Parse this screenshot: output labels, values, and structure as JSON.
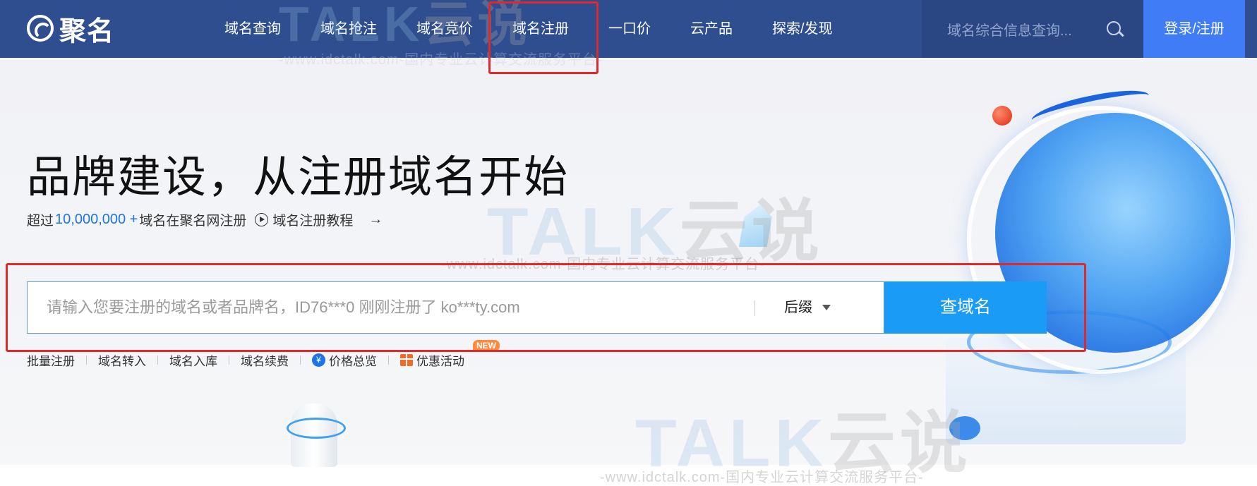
{
  "brand": {
    "logo_text": "聚名"
  },
  "nav": {
    "items": [
      {
        "label": "域名查询"
      },
      {
        "label": "域名抢注"
      },
      {
        "label": "域名竞价"
      },
      {
        "label": "域名注册"
      },
      {
        "label": "一口价"
      },
      {
        "label": "云产品"
      },
      {
        "label": "探索/发现"
      }
    ],
    "search_placeholder": "域名综合信息查询...",
    "login_label": "登录/注册"
  },
  "hero": {
    "headline": "品牌建设，从注册域名开始",
    "sub_prefix": "超过",
    "sub_number": "10,000,000 +",
    "sub_suffix": "域名在聚名网注册",
    "tutorial_label": "域名注册教程",
    "arrow": "→"
  },
  "search": {
    "placeholder": "请输入您要注册的域名或者品牌名，ID76***0 刚刚注册了 ko***ty.com",
    "suffix_label": "后缀",
    "button_label": "查域名"
  },
  "quick_links": [
    {
      "label": "批量注册"
    },
    {
      "label": "域名转入"
    },
    {
      "label": "域名入库"
    },
    {
      "label": "域名续费"
    },
    {
      "label": "价格总览",
      "icon": "yen-icon"
    },
    {
      "label": "优惠活动",
      "icon": "gift-icon"
    }
  ],
  "badge": {
    "new": "NEW"
  },
  "watermark": {
    "logo": "TALK",
    "logo_cn": "云说",
    "url": "-www.idctalk.com-国内专业云计算交流服务平台-"
  },
  "colors": {
    "nav_bg": "#2f4e8f",
    "login_bg": "#3f7cf5",
    "search_button": "#1a9bf5",
    "accent_number": "#1d74e8",
    "highlight_box": "#e02a2a"
  }
}
